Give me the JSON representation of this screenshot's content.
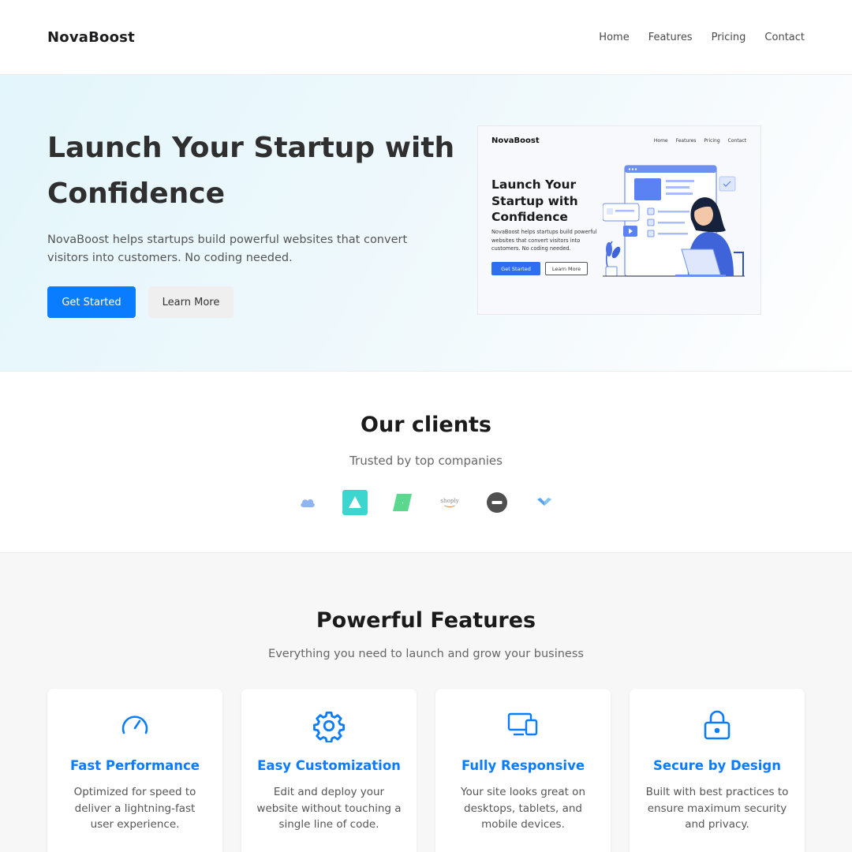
{
  "header": {
    "brand": "NovaBoost",
    "nav": [
      "Home",
      "Features",
      "Pricing",
      "Contact"
    ]
  },
  "hero": {
    "title": "Launch Your Startup with Confidence",
    "description": "NovaBoost helps startups build powerful websites that convert visitors into customers. No coding needed.",
    "primary_button": "Get Started",
    "secondary_button": "Learn More",
    "preview": {
      "brand": "NovaBoost",
      "nav": [
        "Home",
        "Features",
        "Pricing",
        "Contact"
      ],
      "title": "Launch Your Startup with Confidence",
      "description": "NovaBoost helps startups build powerful websites that convert visitors into customers. No coding needed.",
      "primary_button": "Get Started",
      "secondary_button": "Learn More"
    }
  },
  "clients": {
    "title": "Our clients",
    "subtitle": "Trusted by top companies",
    "logos": [
      {
        "name": "cloud-logo",
        "color": "#8fb4f2"
      },
      {
        "name": "triangle-logo",
        "color": "#3dd6cf"
      },
      {
        "name": "parallelogram-logo",
        "color": "#5cd88e"
      },
      {
        "name": "shoply-logo",
        "text": "shoply",
        "color": "#888888"
      },
      {
        "name": "minus-circle-logo",
        "color": "#505050"
      },
      {
        "name": "chevron-logo",
        "color": "#5aa3f0"
      }
    ]
  },
  "features": {
    "title": "Powerful Features",
    "subtitle": "Everything you need to launch and grow your business",
    "accent": "#0a7cff",
    "cards": [
      {
        "icon": "speedometer-icon",
        "title": "Fast Performance",
        "description": "Optimized for speed to deliver a lightning-fast user experience."
      },
      {
        "icon": "gear-icon",
        "title": "Easy Customization",
        "description": "Edit and deploy your website without touching a single line of code."
      },
      {
        "icon": "devices-icon",
        "title": "Fully Responsive",
        "description": "Your site looks great on desktops, tablets, and mobile devices."
      },
      {
        "icon": "lock-icon",
        "title": "Secure by Design",
        "description": "Built with best practices to ensure maximum security and privacy."
      }
    ]
  }
}
